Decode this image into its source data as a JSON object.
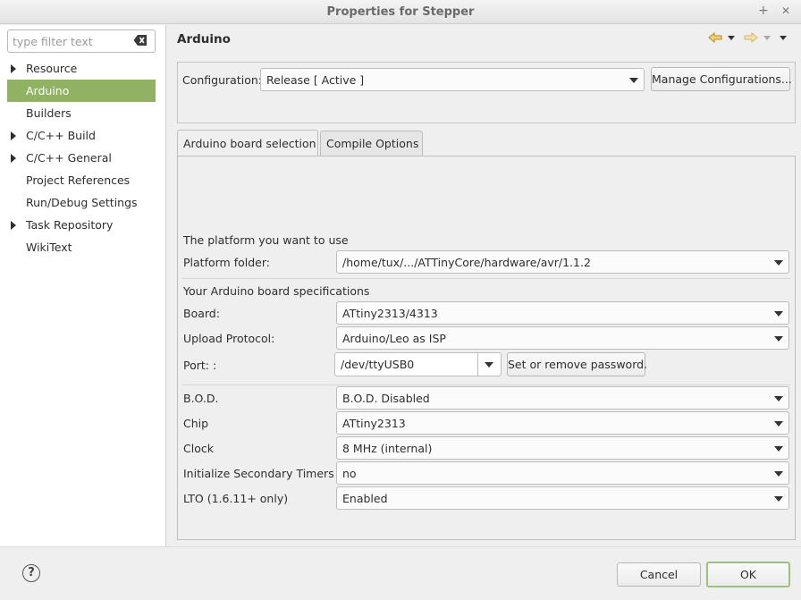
{
  "window": {
    "title": "Properties for Stepper",
    "add_symbol": "+",
    "close_symbol": "✕"
  },
  "sidebar": {
    "filter_placeholder": "type filter text",
    "items": [
      {
        "label": "Resource",
        "expandable": true
      },
      {
        "label": "Arduino",
        "expandable": false,
        "selected": true
      },
      {
        "label": "Builders",
        "expandable": false
      },
      {
        "label": "C/C++ Build",
        "expandable": true
      },
      {
        "label": "C/C++ General",
        "expandable": true
      },
      {
        "label": "Project References",
        "expandable": false
      },
      {
        "label": "Run/Debug Settings",
        "expandable": false
      },
      {
        "label": "Task Repository",
        "expandable": true
      },
      {
        "label": "WikiText",
        "expandable": false
      }
    ]
  },
  "page": {
    "heading": "Arduino",
    "configuration_label": "Configuration:",
    "configuration_value": "Release  [ Active ]",
    "manage_button": "Manage Configurations...",
    "tabs": [
      {
        "label": "Arduino board selection",
        "active": true
      },
      {
        "label": "Compile Options",
        "active": false
      }
    ]
  },
  "board_selection": {
    "platform_section": "The platform you want to use",
    "platform_folder_label": "Platform folder:",
    "platform_folder_value": "/home/tux/.../ATTinyCore/hardware/avr/1.1.2",
    "board_section": "Your Arduino board specifications",
    "board_label": "Board:",
    "board_value": "ATtiny2313/4313",
    "upload_label": "Upload Protocol:",
    "upload_value": "Arduino/Leo as ISP",
    "port_label": "Port: :",
    "port_value": "/dev/ttyUSB0",
    "password_button": "Set or remove password.",
    "bod_label": "B.O.D.",
    "bod_value": "B.O.D. Disabled",
    "chip_label": "Chip",
    "chip_value": "ATtiny2313",
    "clock_label": "Clock",
    "clock_value": "8 MHz (internal)",
    "timers_label": "Initialize Secondary Timers",
    "timers_value": "no",
    "lto_label": "LTO (1.6.11+ only)",
    "lto_value": "Enabled"
  },
  "footer": {
    "help_symbol": "?",
    "cancel_button": "Cancel",
    "ok_button": "OK"
  },
  "colors": {
    "selection": "#90b262",
    "ok_border": "#9fc083",
    "nav_arrow": "#e8b84a"
  }
}
